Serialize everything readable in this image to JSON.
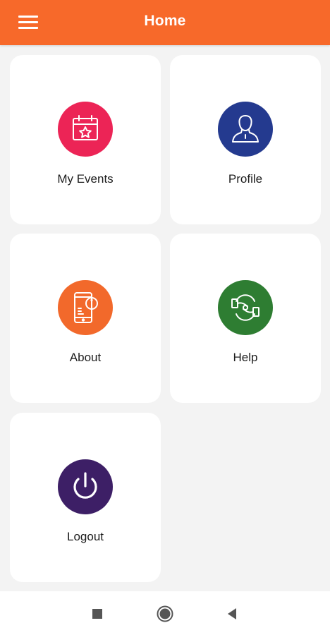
{
  "header": {
    "title": "Home",
    "menu_icon": "hamburger-menu-icon",
    "background_color": "#f7692a"
  },
  "tiles": [
    {
      "label": "My Events",
      "icon": "calendar-star-icon",
      "color": "#ec2456"
    },
    {
      "label": "Profile",
      "icon": "user-profile-icon",
      "color": "#243a8f"
    },
    {
      "label": "About",
      "icon": "phone-info-icon",
      "color": "#f2692b"
    },
    {
      "label": "Help",
      "icon": "helping-hands-icon",
      "color": "#2e7d32"
    },
    {
      "label": "Logout",
      "icon": "power-icon",
      "color": "#3d1f66"
    }
  ],
  "system_nav": {
    "recents_icon": "square-recents-icon",
    "home_icon": "circle-home-icon",
    "back_icon": "triangle-back-icon"
  }
}
